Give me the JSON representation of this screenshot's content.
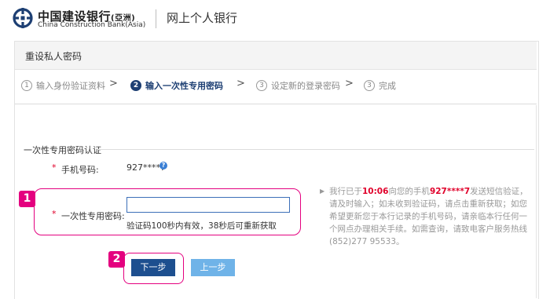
{
  "header": {
    "logo_icon": "ccb-logo-icon",
    "logo_cn_main": "中国建设银行",
    "logo_cn_asia": "(亞洲)",
    "logo_en": "China Construction Bank(Asia)",
    "title": "网上个人银行",
    "brand_color": "#1d3f73"
  },
  "panel": {
    "title": "重设私人密码"
  },
  "steps": [
    {
      "num": "1",
      "label": "输入身份验证资料",
      "active": false
    },
    {
      "num": "2",
      "label": "输入一次性专用密码",
      "active": true
    },
    {
      "num": "3",
      "label": "设定新的登录密码",
      "active": false
    },
    {
      "num": "3",
      "label": "完成",
      "active": false
    }
  ],
  "section": {
    "title": "一次性专用密码认证"
  },
  "form": {
    "required_mark": "*",
    "phone_label": "手机号码:",
    "phone_value": "927****7",
    "otp_label": "一次性专用密码:",
    "otp_value": "",
    "otp_hint": "验证码100秒内有效，38秒后可重新获取"
  },
  "info": {
    "prefix": "我行已于",
    "time": "10:06",
    "mid": "向您的手机",
    "phone": "927****7",
    "rest": "发送短信验证，请及时输入；如未收到验证码，请点击重新获取；如您希望更新您于本行记录的手机号码，请亲临本行任何一个网点办理相关手续。如需查询，请致电客户服务热线 (852)277 95533。"
  },
  "buttons": {
    "next": "下一步",
    "prev": "上一步"
  },
  "annotations": {
    "badge_1": "1",
    "badge_2": "2",
    "highlight_color": "#e4007f"
  }
}
